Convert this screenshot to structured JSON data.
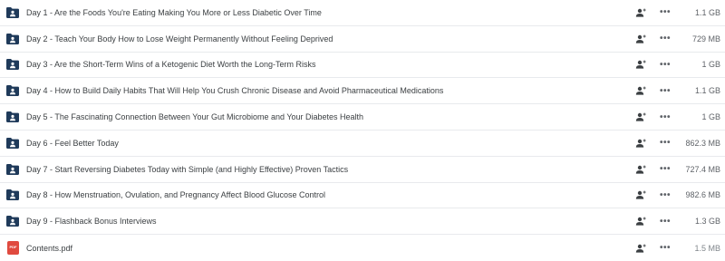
{
  "files": [
    {
      "type": "folder",
      "name": "Day 1 - Are the Foods You're Eating Making You More or Less Diabetic Over Time",
      "size": "1.1 GB"
    },
    {
      "type": "folder",
      "name": "Day 2 - Teach Your Body How to Lose Weight Permanently Without Feeling Deprived",
      "size": "729 MB"
    },
    {
      "type": "folder",
      "name": "Day 3 - Are the Short-Term Wins of a Ketogenic Diet Worth the Long-Term Risks",
      "size": "1 GB"
    },
    {
      "type": "folder",
      "name": "Day 4 - How to Build Daily Habits That Will Help You Crush Chronic Disease and Avoid Pharmaceutical Medications",
      "size": "1.1 GB"
    },
    {
      "type": "folder",
      "name": "Day 5 - The Fascinating Connection Between Your Gut Microbiome and Your Diabetes Health",
      "size": "1 GB"
    },
    {
      "type": "folder",
      "name": "Day 6 - Feel Better Today",
      "size": "862.3 MB"
    },
    {
      "type": "folder",
      "name": "Day 7 - Start Reversing Diabetes Today with Simple (and Highly Effective) Proven Tactics",
      "size": "727.4 MB"
    },
    {
      "type": "folder",
      "name": "Day 8 - How Menstruation, Ovulation, and Pregnancy Affect Blood Glucose Control",
      "size": "982.6 MB"
    },
    {
      "type": "folder",
      "name": "Day 9 - Flashback Bonus Interviews",
      "size": "1.3 GB"
    },
    {
      "type": "pdf",
      "name": "Contents.pdf",
      "size": "1.5 MB",
      "icon_label": "PDF"
    }
  ],
  "more_label": "•••",
  "colors": {
    "folder": "#1f3a5a",
    "pdf": "#e04a3f",
    "divider": "#e8eaed"
  },
  "icons": {
    "folder": "shared-folder-icon",
    "share": "share-person-icon",
    "more": "more-options-icon",
    "pdf": "pdf-file-icon"
  }
}
